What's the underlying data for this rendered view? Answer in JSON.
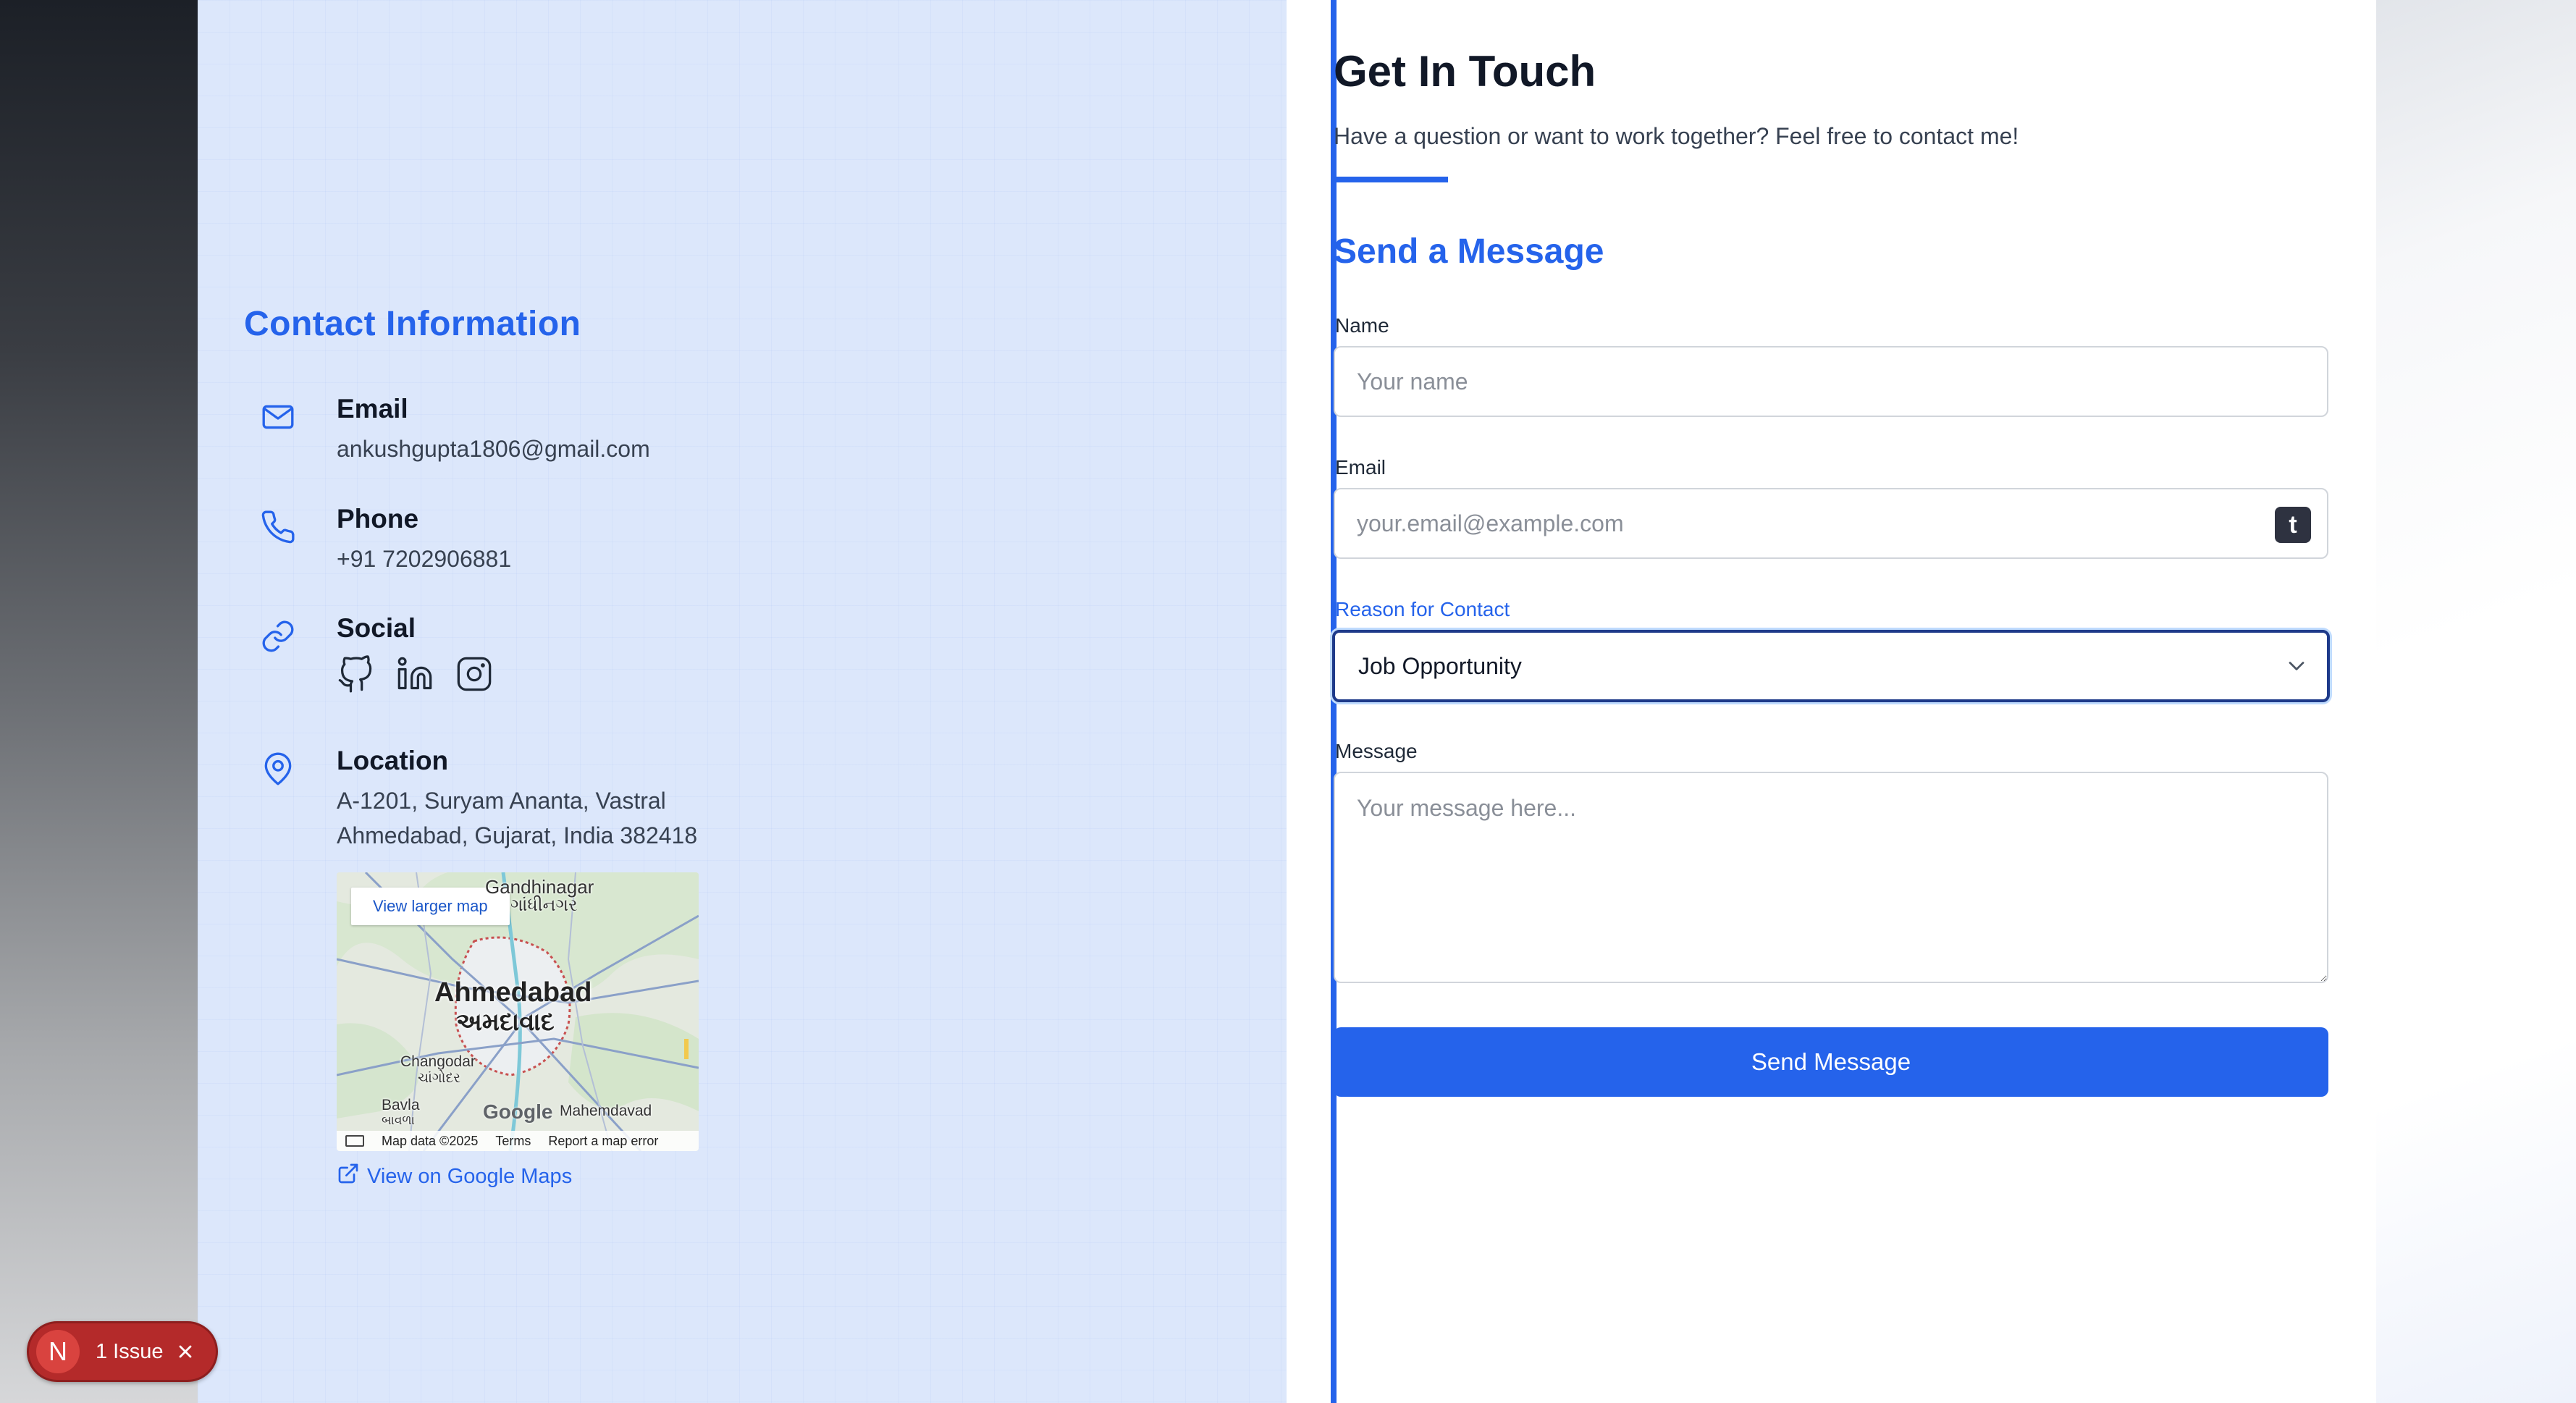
{
  "contact": {
    "title": "Contact Information",
    "email": {
      "label": "Email",
      "value": "ankushgupta1806@gmail.com",
      "icon": "mail-icon"
    },
    "phone": {
      "label": "Phone",
      "value": "+91 7202906881",
      "icon": "phone-icon"
    },
    "social": {
      "label": "Social",
      "icon": "link-icon",
      "links": [
        "github-icon",
        "linkedin-icon",
        "instagram-icon"
      ]
    },
    "location": {
      "label": "Location",
      "line1": "A-1201, Suryam Ananta, Vastral",
      "line2": "Ahmedabad, Gujarat, India 382418",
      "icon": "map-pin-icon"
    },
    "map": {
      "view_larger": "View larger map",
      "city": "Ahmedabad",
      "city_gujarati": "અમદાવાદ",
      "gandhinagar": "Gandhinagar",
      "gandhinagar_gujarati": "ગાંધીનગર",
      "changodar": "Changodar",
      "changodar_gujarati": "ચાંગોદર",
      "bavla": "Bavla",
      "bavla_gujarati": "બાવળા",
      "mahemdavad": "Mahemdavad",
      "google": "Google",
      "map_data": "Map data ©2025",
      "terms": "Terms",
      "report": "Report a map error"
    },
    "google_maps_link": "View on Google Maps"
  },
  "form": {
    "heading": "Get In Touch",
    "subheading": "Have a question or want to work together? Feel free to contact me!",
    "section_title": "Send a Message",
    "name": {
      "label": "Name",
      "placeholder": "Your name"
    },
    "email": {
      "label": "Email",
      "placeholder": "your.email@example.com",
      "extension_badge": "t"
    },
    "reason": {
      "label": "Reason for Contact",
      "selected": "Job Opportunity"
    },
    "message": {
      "label": "Message",
      "placeholder": "Your message here..."
    },
    "submit_label": "Send Message"
  },
  "issue_badge": {
    "logo": "N",
    "text": "1 Issue"
  },
  "colors": {
    "accent": "#2563eb",
    "panel_bg": "#dce7fb",
    "issue_red": "#b42a2a"
  }
}
